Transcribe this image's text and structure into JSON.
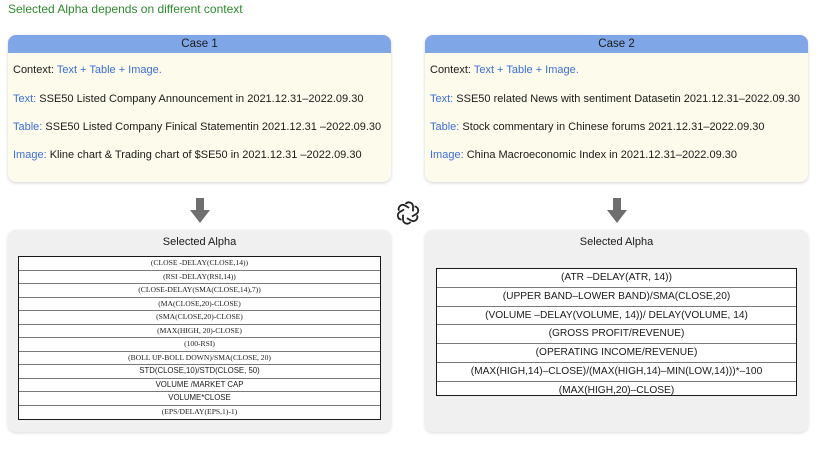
{
  "title": "Selected Alpha depends on different context",
  "colors": {
    "header_blue": "#7fa7e8",
    "key_blue": "#3b6fd6",
    "title_green": "#2f8a2f",
    "case_bg": "#fdfbec",
    "panel_bg": "#f0f0f0"
  },
  "logo_icon": "openai-logo-icon",
  "arrow_icon": "down-arrow-icon",
  "cases": [
    {
      "header": "Case 1",
      "rows": [
        {
          "key": "Context:",
          "value": "Text + Table + Image.",
          "key_color": "dark",
          "value_color": "blue"
        },
        {
          "key": "Text:",
          "value": "SSE50 Listed Company Announcement in 2021.12.31–2022.09.30"
        },
        {
          "key": "Table:",
          "value": "SSE50 Listed Company Finical Statementin 2021.12.31 –2022.09.30"
        },
        {
          "key": "Image:",
          "value": "Kline chart & Trading chart of $SE50 in 2021.12.31 –2022.09.30"
        }
      ]
    },
    {
      "header": "Case 2",
      "rows": [
        {
          "key": "Context:",
          "value": "Text + Table + Image.",
          "key_color": "dark",
          "value_color": "blue"
        },
        {
          "key": "Text:",
          "value": "SSE50 related News with sentiment Datasetin 2021.12.31–2022.09.30"
        },
        {
          "key": "Table:",
          "value": "Stock commentary in Chinese forums 2021.12.31–2022.09.30"
        },
        {
          "key": "Image:",
          "value": "China Macroeconomic Index in 2021.12.31–2022.09.30"
        }
      ]
    }
  ],
  "panels": [
    {
      "title": "Selected Alpha",
      "alphas": [
        "(CLOSE -DELAY(CLOSE,14))",
        "(RSI -DELAY(RSI,14))",
        "(CLOSE-DELAY(SMA(CLOSE,14),7))",
        "(MA(CLOSE,20)-CLOSE)",
        "(SMA(CLOSE,20)-CLOSE)",
        "(MAX(HIGH, 20)-CLOSE)",
        "(100-RSI)",
        "(BOLL UP-BOLL DOWN)/SMA(CLOSE, 20)",
        "STD(CLOSE,10)/STD(CLOSE, 50)",
        "VOLUME /MARKET CAP",
        "VOLUME*CLOSE",
        "(EPS/DELAY(EPS,1)-1)"
      ]
    },
    {
      "title": "Selected Alpha",
      "alphas": [
        "(ATR –DELAY(ATR, 14))",
        "(UPPER BAND–LOWER BAND)/SMA(CLOSE,20)",
        "(VOLUME –DELAY(VOLUME, 14))/ DELAY(VOLUME, 14)",
        "(GROSS PROFIT/REVENUE)",
        "(OPERATING INCOME/REVENUE)",
        "(MAX(HIGH,14)–CLOSE)/(MAX(HIGH,14)–MIN(LOW,14)))*–100",
        "(MAX(HIGH,20)–CLOSE)"
      ]
    }
  ]
}
